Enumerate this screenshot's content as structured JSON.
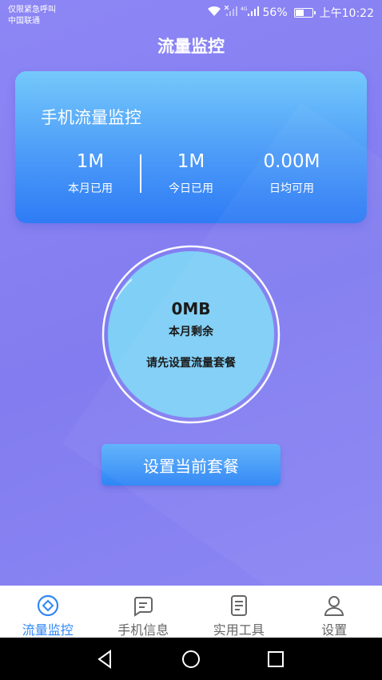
{
  "status_bar": {
    "carrier_line1": "仅限紧急呼叫",
    "carrier_line2": "中国联通",
    "network": "4G",
    "battery": "56%",
    "battery_level": 0.56,
    "time": "上午10:22"
  },
  "header": {
    "title": "流量监控"
  },
  "stats_card": {
    "title": "手机流量监控",
    "stats": [
      {
        "value": "1M",
        "label": "本月已用"
      },
      {
        "value": "1M",
        "label": "今日已用"
      },
      {
        "value": "0.00M",
        "label": "日均可用"
      }
    ]
  },
  "gauge": {
    "value": "0MB",
    "label": "本月剩余",
    "hint": "请先设置流量套餐",
    "fill_color": "#7fcff6",
    "ring_color": "#ffffff"
  },
  "setup_button": {
    "label": "设置当前套餐"
  },
  "bottom_nav": {
    "active_color": "#2f86f5",
    "items": [
      {
        "label": "流量监控",
        "icon": "target-icon",
        "active": true
      },
      {
        "label": "手机信息",
        "icon": "message-icon",
        "active": false
      },
      {
        "label": "实用工具",
        "icon": "document-icon",
        "active": false
      },
      {
        "label": "设置",
        "icon": "user-icon",
        "active": false
      }
    ]
  },
  "system_nav": {
    "items": [
      "back-icon",
      "home-icon",
      "recents-icon"
    ]
  }
}
